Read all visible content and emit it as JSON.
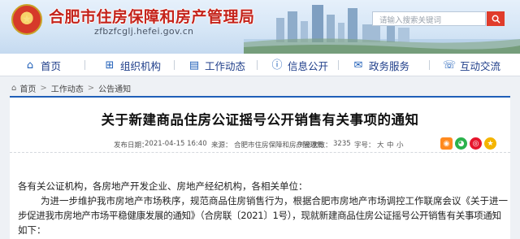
{
  "header": {
    "site_title": "合肥市住房保障和房产管理局",
    "site_url": "zfbzfcglj.hefei.gov.cn",
    "emblem_icon": "national-emblem-icon",
    "search_placeholder": "请输入搜索关键词",
    "search_icon": "search-icon"
  },
  "nav": {
    "items": [
      {
        "label": "首页",
        "icon": "home-icon"
      },
      {
        "label": "组织机构",
        "icon": "organization-icon"
      },
      {
        "label": "工作动态",
        "icon": "work-news-icon"
      },
      {
        "label": "信息公开",
        "icon": "info-public-icon"
      },
      {
        "label": "政务服务",
        "icon": "service-icon"
      },
      {
        "label": "互动交流",
        "icon": "interaction-icon"
      }
    ]
  },
  "breadcrumb": {
    "items": [
      "首页",
      "工作动态",
      "公告通知"
    ]
  },
  "article": {
    "title": "关于新建商品住房公证摇号公开销售有关事项的通知",
    "meta": {
      "publish_label": "发布日期：",
      "publish_value": "2021-04-15 16:40",
      "source_label": "来源：",
      "source_value": "合肥市住房保障和房产管理局",
      "views_label": "浏览次数：",
      "views_value": "3235",
      "font_label": "字号：",
      "font_large": "大",
      "font_medium": "中",
      "font_small": "小"
    },
    "share_icons": [
      "rss-icon",
      "wechat-icon",
      "weibo-icon",
      "qzone-icon"
    ],
    "paragraphs": {
      "salutation": "各有关公证机构，各房地产开发企业、房地产经纪机构，各相关单位：",
      "line1": "为进一步维护我市房地产市场秩序，规范商品住房销售行为，根据合肥市房地产市场调控工作联席会议《关于进一",
      "line2": "步促进我市房地产市场平稳健康发展的通知》（合房联〔2021〕1号），现就新建商品住房公证摇号公开销售有关事项通知",
      "line3": "如下："
    }
  },
  "colors": {
    "title_red": "#c4231b",
    "nav_blue": "#1f3e8a",
    "accent_blue": "#1f5fb8",
    "search_button": "#e03c2b"
  }
}
